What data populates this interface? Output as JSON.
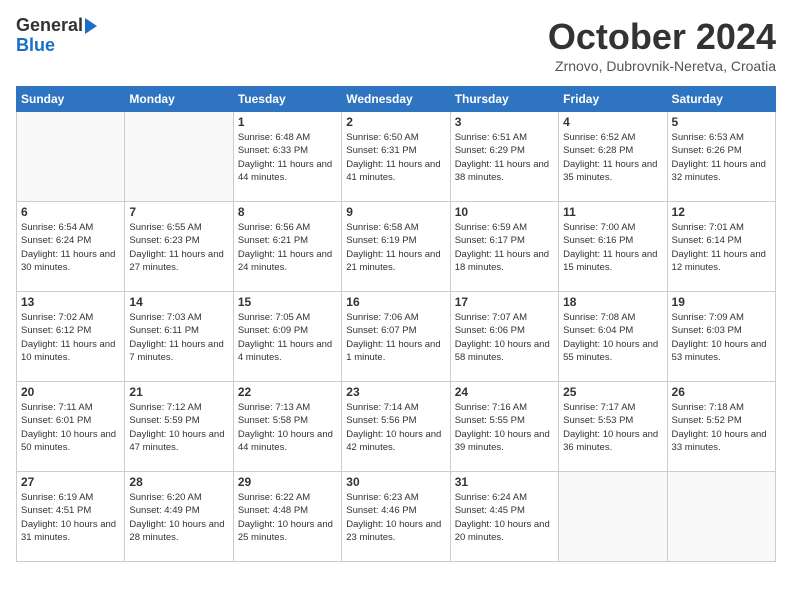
{
  "header": {
    "logo_general": "General",
    "logo_blue": "Blue",
    "title": "October 2024",
    "subtitle": "Zrnovo, Dubrovnik-Neretva, Croatia"
  },
  "weekdays": [
    "Sunday",
    "Monday",
    "Tuesday",
    "Wednesday",
    "Thursday",
    "Friday",
    "Saturday"
  ],
  "weeks": [
    [
      {
        "day": "",
        "sunrise": "",
        "sunset": "",
        "daylight": ""
      },
      {
        "day": "",
        "sunrise": "",
        "sunset": "",
        "daylight": ""
      },
      {
        "day": "1",
        "sunrise": "Sunrise: 6:48 AM",
        "sunset": "Sunset: 6:33 PM",
        "daylight": "Daylight: 11 hours and 44 minutes."
      },
      {
        "day": "2",
        "sunrise": "Sunrise: 6:50 AM",
        "sunset": "Sunset: 6:31 PM",
        "daylight": "Daylight: 11 hours and 41 minutes."
      },
      {
        "day": "3",
        "sunrise": "Sunrise: 6:51 AM",
        "sunset": "Sunset: 6:29 PM",
        "daylight": "Daylight: 11 hours and 38 minutes."
      },
      {
        "day": "4",
        "sunrise": "Sunrise: 6:52 AM",
        "sunset": "Sunset: 6:28 PM",
        "daylight": "Daylight: 11 hours and 35 minutes."
      },
      {
        "day": "5",
        "sunrise": "Sunrise: 6:53 AM",
        "sunset": "Sunset: 6:26 PM",
        "daylight": "Daylight: 11 hours and 32 minutes."
      }
    ],
    [
      {
        "day": "6",
        "sunrise": "Sunrise: 6:54 AM",
        "sunset": "Sunset: 6:24 PM",
        "daylight": "Daylight: 11 hours and 30 minutes."
      },
      {
        "day": "7",
        "sunrise": "Sunrise: 6:55 AM",
        "sunset": "Sunset: 6:23 PM",
        "daylight": "Daylight: 11 hours and 27 minutes."
      },
      {
        "day": "8",
        "sunrise": "Sunrise: 6:56 AM",
        "sunset": "Sunset: 6:21 PM",
        "daylight": "Daylight: 11 hours and 24 minutes."
      },
      {
        "day": "9",
        "sunrise": "Sunrise: 6:58 AM",
        "sunset": "Sunset: 6:19 PM",
        "daylight": "Daylight: 11 hours and 21 minutes."
      },
      {
        "day": "10",
        "sunrise": "Sunrise: 6:59 AM",
        "sunset": "Sunset: 6:17 PM",
        "daylight": "Daylight: 11 hours and 18 minutes."
      },
      {
        "day": "11",
        "sunrise": "Sunrise: 7:00 AM",
        "sunset": "Sunset: 6:16 PM",
        "daylight": "Daylight: 11 hours and 15 minutes."
      },
      {
        "day": "12",
        "sunrise": "Sunrise: 7:01 AM",
        "sunset": "Sunset: 6:14 PM",
        "daylight": "Daylight: 11 hours and 12 minutes."
      }
    ],
    [
      {
        "day": "13",
        "sunrise": "Sunrise: 7:02 AM",
        "sunset": "Sunset: 6:12 PM",
        "daylight": "Daylight: 11 hours and 10 minutes."
      },
      {
        "day": "14",
        "sunrise": "Sunrise: 7:03 AM",
        "sunset": "Sunset: 6:11 PM",
        "daylight": "Daylight: 11 hours and 7 minutes."
      },
      {
        "day": "15",
        "sunrise": "Sunrise: 7:05 AM",
        "sunset": "Sunset: 6:09 PM",
        "daylight": "Daylight: 11 hours and 4 minutes."
      },
      {
        "day": "16",
        "sunrise": "Sunrise: 7:06 AM",
        "sunset": "Sunset: 6:07 PM",
        "daylight": "Daylight: 11 hours and 1 minute."
      },
      {
        "day": "17",
        "sunrise": "Sunrise: 7:07 AM",
        "sunset": "Sunset: 6:06 PM",
        "daylight": "Daylight: 10 hours and 58 minutes."
      },
      {
        "day": "18",
        "sunrise": "Sunrise: 7:08 AM",
        "sunset": "Sunset: 6:04 PM",
        "daylight": "Daylight: 10 hours and 55 minutes."
      },
      {
        "day": "19",
        "sunrise": "Sunrise: 7:09 AM",
        "sunset": "Sunset: 6:03 PM",
        "daylight": "Daylight: 10 hours and 53 minutes."
      }
    ],
    [
      {
        "day": "20",
        "sunrise": "Sunrise: 7:11 AM",
        "sunset": "Sunset: 6:01 PM",
        "daylight": "Daylight: 10 hours and 50 minutes."
      },
      {
        "day": "21",
        "sunrise": "Sunrise: 7:12 AM",
        "sunset": "Sunset: 5:59 PM",
        "daylight": "Daylight: 10 hours and 47 minutes."
      },
      {
        "day": "22",
        "sunrise": "Sunrise: 7:13 AM",
        "sunset": "Sunset: 5:58 PM",
        "daylight": "Daylight: 10 hours and 44 minutes."
      },
      {
        "day": "23",
        "sunrise": "Sunrise: 7:14 AM",
        "sunset": "Sunset: 5:56 PM",
        "daylight": "Daylight: 10 hours and 42 minutes."
      },
      {
        "day": "24",
        "sunrise": "Sunrise: 7:16 AM",
        "sunset": "Sunset: 5:55 PM",
        "daylight": "Daylight: 10 hours and 39 minutes."
      },
      {
        "day": "25",
        "sunrise": "Sunrise: 7:17 AM",
        "sunset": "Sunset: 5:53 PM",
        "daylight": "Daylight: 10 hours and 36 minutes."
      },
      {
        "day": "26",
        "sunrise": "Sunrise: 7:18 AM",
        "sunset": "Sunset: 5:52 PM",
        "daylight": "Daylight: 10 hours and 33 minutes."
      }
    ],
    [
      {
        "day": "27",
        "sunrise": "Sunrise: 6:19 AM",
        "sunset": "Sunset: 4:51 PM",
        "daylight": "Daylight: 10 hours and 31 minutes."
      },
      {
        "day": "28",
        "sunrise": "Sunrise: 6:20 AM",
        "sunset": "Sunset: 4:49 PM",
        "daylight": "Daylight: 10 hours and 28 minutes."
      },
      {
        "day": "29",
        "sunrise": "Sunrise: 6:22 AM",
        "sunset": "Sunset: 4:48 PM",
        "daylight": "Daylight: 10 hours and 25 minutes."
      },
      {
        "day": "30",
        "sunrise": "Sunrise: 6:23 AM",
        "sunset": "Sunset: 4:46 PM",
        "daylight": "Daylight: 10 hours and 23 minutes."
      },
      {
        "day": "31",
        "sunrise": "Sunrise: 6:24 AM",
        "sunset": "Sunset: 4:45 PM",
        "daylight": "Daylight: 10 hours and 20 minutes."
      },
      {
        "day": "",
        "sunrise": "",
        "sunset": "",
        "daylight": ""
      },
      {
        "day": "",
        "sunrise": "",
        "sunset": "",
        "daylight": ""
      }
    ]
  ]
}
